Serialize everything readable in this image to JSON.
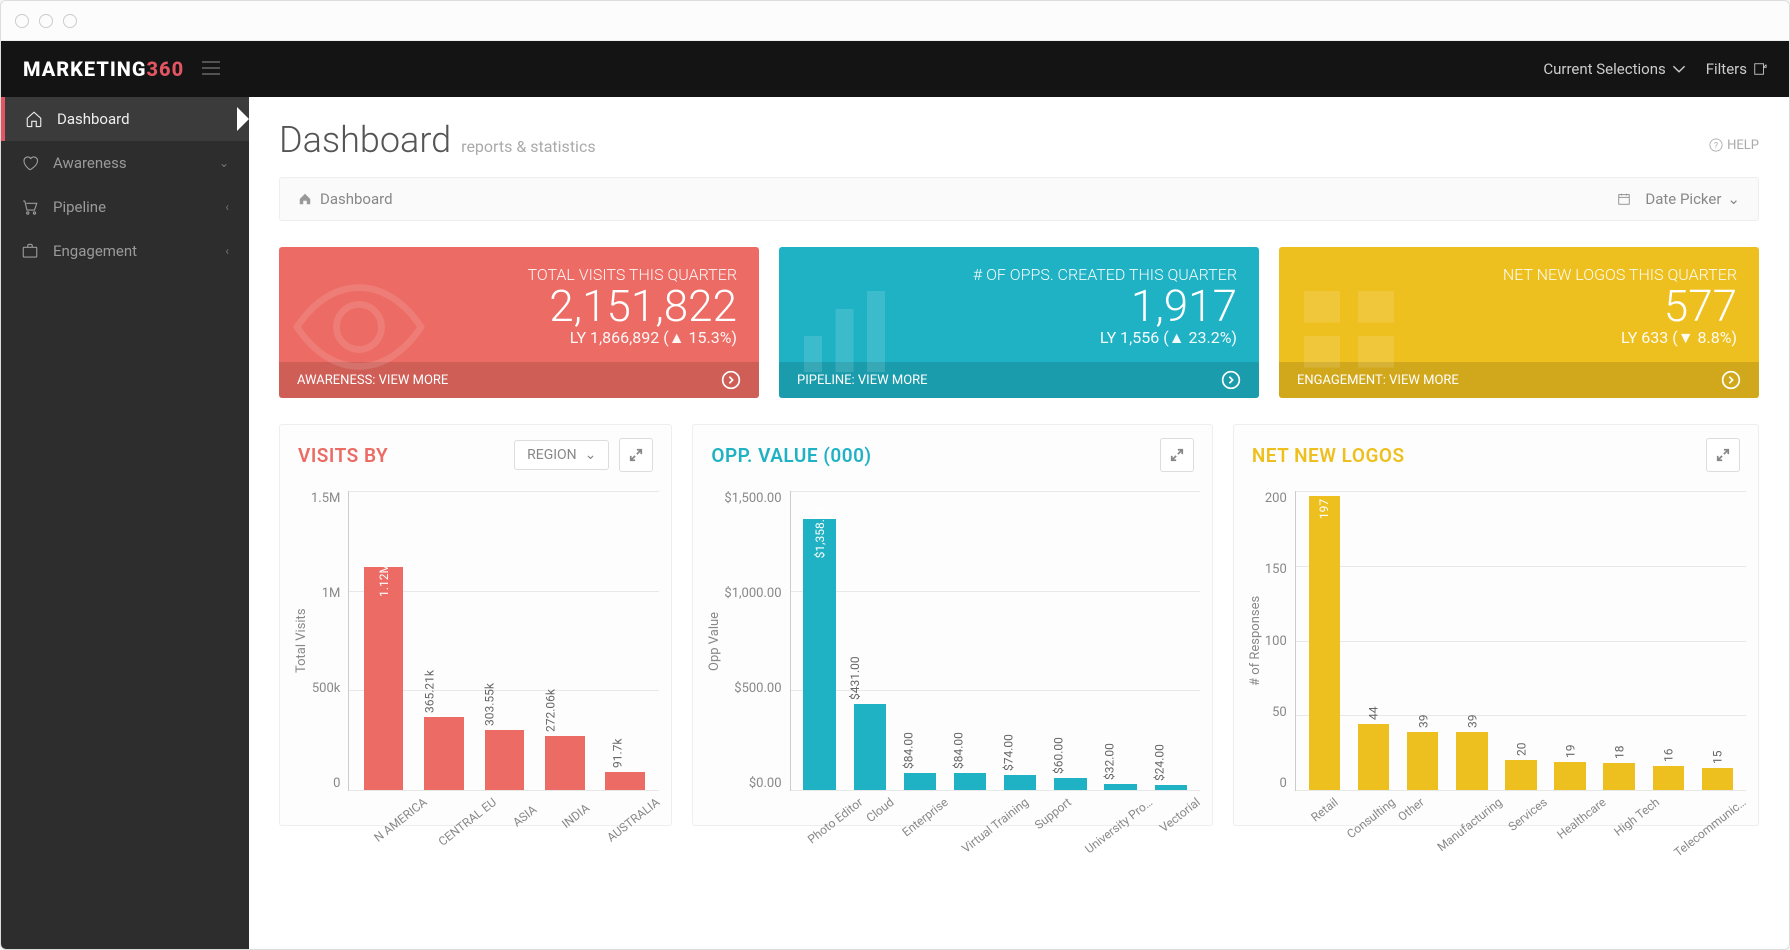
{
  "brand": {
    "text1": "MARKETING",
    "text2": "360"
  },
  "topbar": {
    "selections": "Current Selections",
    "filters": "Filters"
  },
  "sidebar": {
    "items": [
      {
        "label": "Dashboard"
      },
      {
        "label": "Awareness"
      },
      {
        "label": "Pipeline"
      },
      {
        "label": "Engagement"
      }
    ]
  },
  "page": {
    "title": "Dashboard",
    "subtitle": "reports & statistics",
    "help": "HELP"
  },
  "breadcrumb": {
    "label": "Dashboard",
    "date_picker": "Date Picker"
  },
  "kpis": [
    {
      "label": "TOTAL VISITS THIS QUARTER",
      "value": "2,151,822",
      "ly": "LY 1,866,892 (▲ 15.3%)",
      "footer": "AWARENESS: VIEW MORE",
      "color": "#ec6b64"
    },
    {
      "label": "# OF OPPS. CREATED THIS QUARTER",
      "value": "1,917",
      "ly": "LY 1,556 (▲ 23.2%)",
      "footer": "PIPELINE: VIEW MORE",
      "color": "#1fb2c4"
    },
    {
      "label": "NET NEW LOGOS THIS QUARTER",
      "value": "577",
      "ly": "LY 633 (▼ 8.8%)",
      "footer": "ENGAGEMENT: VIEW MORE",
      "color": "#eec01f"
    }
  ],
  "card1": {
    "title": "VISITS BY",
    "dropdown": "REGION"
  },
  "card2": {
    "title": "OPP. VALUE (000)"
  },
  "card3": {
    "title": "NET NEW LOGOS"
  },
  "chart_data": [
    {
      "type": "bar",
      "title": "VISITS BY REGION",
      "ylabel": "Total Visits",
      "ylim": [
        0,
        1500000
      ],
      "yticks": [
        "0",
        "500k",
        "1M",
        "1.5M"
      ],
      "categories": [
        "N AMERICA",
        "CENTRAL EU",
        "ASIA",
        "INDIA",
        "AUSTRALIA"
      ],
      "values": [
        1120000,
        365210,
        303550,
        272060,
        91700
      ],
      "labels": [
        "1.12M",
        "365.21k",
        "303.55k",
        "272.06k",
        "91.7k"
      ],
      "color": "#ec6b64"
    },
    {
      "type": "bar",
      "title": "OPP. VALUE (000)",
      "ylabel": "Opp Value",
      "ylim": [
        0,
        1500
      ],
      "yticks": [
        "$0.00",
        "$500.00",
        "$1,000.00",
        "$1,500.00"
      ],
      "categories": [
        "Photo Editor",
        "Cloud",
        "Enterprise",
        "Virtual Training",
        "Support",
        "University Pro…",
        "Vectorial"
      ],
      "values": [
        1358,
        431,
        84,
        84,
        74,
        60,
        32,
        24
      ],
      "labels": [
        "$1,358.00",
        "$431.00",
        "$84.00",
        "$84.00",
        "$74.00",
        "$60.00",
        "$32.00",
        "$24.00"
      ],
      "color": "#1fb2c4"
    },
    {
      "type": "bar",
      "title": "NET NEW LOGOS",
      "ylabel": "# of Responses",
      "ylim": [
        0,
        200
      ],
      "yticks": [
        "0",
        "50",
        "100",
        "150",
        "200"
      ],
      "categories": [
        "Retail",
        "Consulting",
        "Other",
        "Manufacturing",
        "Services",
        "Healthcare",
        "High Tech",
        "Telecommunic…"
      ],
      "values": [
        197,
        44,
        39,
        39,
        20,
        19,
        18,
        16,
        15
      ],
      "labels": [
        "197",
        "44",
        "39",
        "39",
        "20",
        "19",
        "18",
        "16",
        "15"
      ],
      "color": "#eec01f"
    }
  ]
}
